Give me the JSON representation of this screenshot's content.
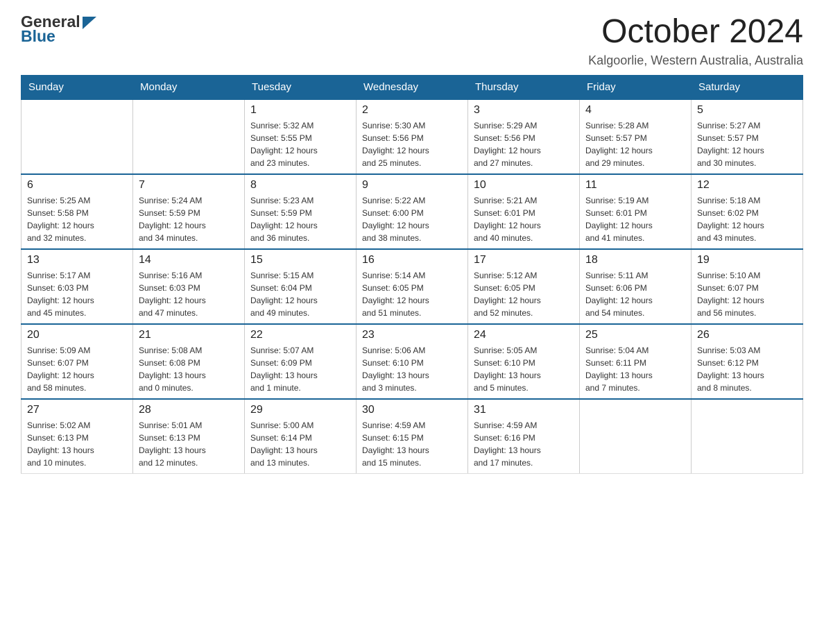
{
  "header": {
    "logo": {
      "text1": "General",
      "text2": "Blue"
    },
    "title": "October 2024",
    "location": "Kalgoorlie, Western Australia, Australia"
  },
  "days_of_week": [
    "Sunday",
    "Monday",
    "Tuesday",
    "Wednesday",
    "Thursday",
    "Friday",
    "Saturday"
  ],
  "weeks": [
    [
      {
        "day": "",
        "info": ""
      },
      {
        "day": "",
        "info": ""
      },
      {
        "day": "1",
        "info": "Sunrise: 5:32 AM\nSunset: 5:55 PM\nDaylight: 12 hours\nand 23 minutes."
      },
      {
        "day": "2",
        "info": "Sunrise: 5:30 AM\nSunset: 5:56 PM\nDaylight: 12 hours\nand 25 minutes."
      },
      {
        "day": "3",
        "info": "Sunrise: 5:29 AM\nSunset: 5:56 PM\nDaylight: 12 hours\nand 27 minutes."
      },
      {
        "day": "4",
        "info": "Sunrise: 5:28 AM\nSunset: 5:57 PM\nDaylight: 12 hours\nand 29 minutes."
      },
      {
        "day": "5",
        "info": "Sunrise: 5:27 AM\nSunset: 5:57 PM\nDaylight: 12 hours\nand 30 minutes."
      }
    ],
    [
      {
        "day": "6",
        "info": "Sunrise: 5:25 AM\nSunset: 5:58 PM\nDaylight: 12 hours\nand 32 minutes."
      },
      {
        "day": "7",
        "info": "Sunrise: 5:24 AM\nSunset: 5:59 PM\nDaylight: 12 hours\nand 34 minutes."
      },
      {
        "day": "8",
        "info": "Sunrise: 5:23 AM\nSunset: 5:59 PM\nDaylight: 12 hours\nand 36 minutes."
      },
      {
        "day": "9",
        "info": "Sunrise: 5:22 AM\nSunset: 6:00 PM\nDaylight: 12 hours\nand 38 minutes."
      },
      {
        "day": "10",
        "info": "Sunrise: 5:21 AM\nSunset: 6:01 PM\nDaylight: 12 hours\nand 40 minutes."
      },
      {
        "day": "11",
        "info": "Sunrise: 5:19 AM\nSunset: 6:01 PM\nDaylight: 12 hours\nand 41 minutes."
      },
      {
        "day": "12",
        "info": "Sunrise: 5:18 AM\nSunset: 6:02 PM\nDaylight: 12 hours\nand 43 minutes."
      }
    ],
    [
      {
        "day": "13",
        "info": "Sunrise: 5:17 AM\nSunset: 6:03 PM\nDaylight: 12 hours\nand 45 minutes."
      },
      {
        "day": "14",
        "info": "Sunrise: 5:16 AM\nSunset: 6:03 PM\nDaylight: 12 hours\nand 47 minutes."
      },
      {
        "day": "15",
        "info": "Sunrise: 5:15 AM\nSunset: 6:04 PM\nDaylight: 12 hours\nand 49 minutes."
      },
      {
        "day": "16",
        "info": "Sunrise: 5:14 AM\nSunset: 6:05 PM\nDaylight: 12 hours\nand 51 minutes."
      },
      {
        "day": "17",
        "info": "Sunrise: 5:12 AM\nSunset: 6:05 PM\nDaylight: 12 hours\nand 52 minutes."
      },
      {
        "day": "18",
        "info": "Sunrise: 5:11 AM\nSunset: 6:06 PM\nDaylight: 12 hours\nand 54 minutes."
      },
      {
        "day": "19",
        "info": "Sunrise: 5:10 AM\nSunset: 6:07 PM\nDaylight: 12 hours\nand 56 minutes."
      }
    ],
    [
      {
        "day": "20",
        "info": "Sunrise: 5:09 AM\nSunset: 6:07 PM\nDaylight: 12 hours\nand 58 minutes."
      },
      {
        "day": "21",
        "info": "Sunrise: 5:08 AM\nSunset: 6:08 PM\nDaylight: 13 hours\nand 0 minutes."
      },
      {
        "day": "22",
        "info": "Sunrise: 5:07 AM\nSunset: 6:09 PM\nDaylight: 13 hours\nand 1 minute."
      },
      {
        "day": "23",
        "info": "Sunrise: 5:06 AM\nSunset: 6:10 PM\nDaylight: 13 hours\nand 3 minutes."
      },
      {
        "day": "24",
        "info": "Sunrise: 5:05 AM\nSunset: 6:10 PM\nDaylight: 13 hours\nand 5 minutes."
      },
      {
        "day": "25",
        "info": "Sunrise: 5:04 AM\nSunset: 6:11 PM\nDaylight: 13 hours\nand 7 minutes."
      },
      {
        "day": "26",
        "info": "Sunrise: 5:03 AM\nSunset: 6:12 PM\nDaylight: 13 hours\nand 8 minutes."
      }
    ],
    [
      {
        "day": "27",
        "info": "Sunrise: 5:02 AM\nSunset: 6:13 PM\nDaylight: 13 hours\nand 10 minutes."
      },
      {
        "day": "28",
        "info": "Sunrise: 5:01 AM\nSunset: 6:13 PM\nDaylight: 13 hours\nand 12 minutes."
      },
      {
        "day": "29",
        "info": "Sunrise: 5:00 AM\nSunset: 6:14 PM\nDaylight: 13 hours\nand 13 minutes."
      },
      {
        "day": "30",
        "info": "Sunrise: 4:59 AM\nSunset: 6:15 PM\nDaylight: 13 hours\nand 15 minutes."
      },
      {
        "day": "31",
        "info": "Sunrise: 4:59 AM\nSunset: 6:16 PM\nDaylight: 13 hours\nand 17 minutes."
      },
      {
        "day": "",
        "info": ""
      },
      {
        "day": "",
        "info": ""
      }
    ]
  ]
}
